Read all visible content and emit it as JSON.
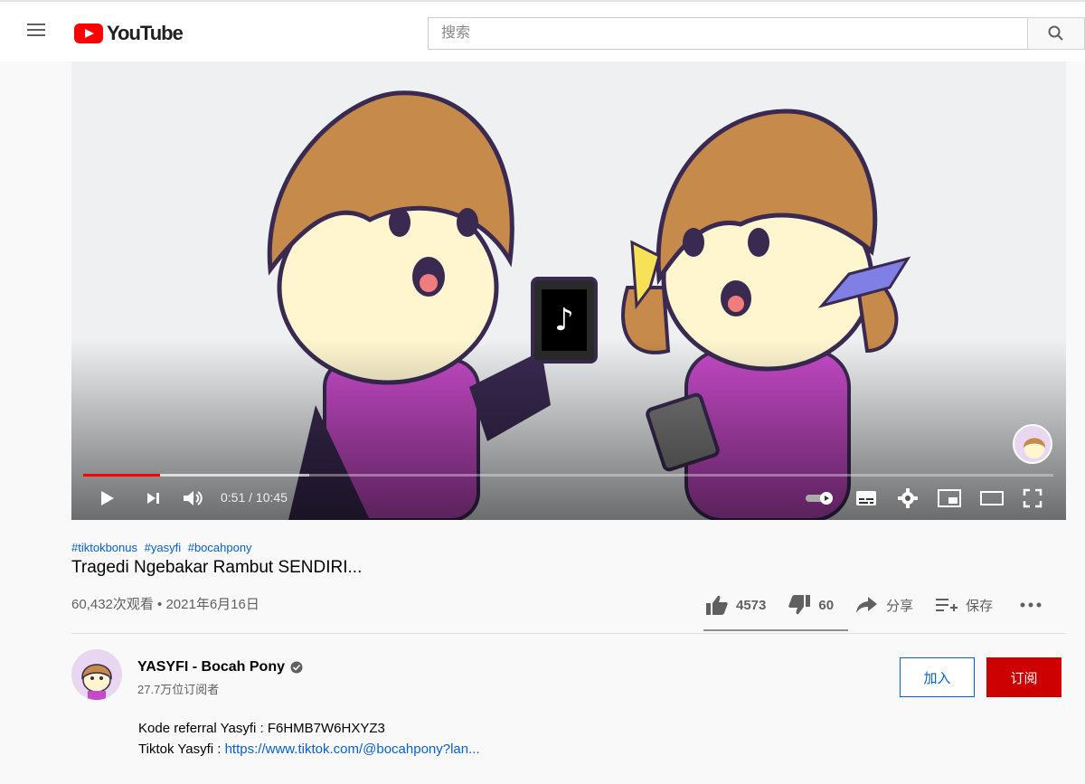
{
  "app": {
    "logo_text": "YouTube"
  },
  "search": {
    "placeholder": "搜索"
  },
  "player": {
    "current_time": "0:51",
    "duration": "10:45",
    "time_display": "0:51 / 10:45",
    "played_fraction": 0.079,
    "colors": {
      "progress_played": "#ff0000"
    }
  },
  "video": {
    "hashtags": [
      "#tiktokbonus",
      "#yasyfi",
      "#bocahpony"
    ],
    "title": "Tragedi Ngebakar Rambut SENDIRI...",
    "meta": "60,432次观看 • 2021年6月16日",
    "likes": "4573",
    "dislikes": "60",
    "share_label": "分享",
    "save_label": "保存"
  },
  "channel": {
    "name": "YASYFI - Bocah Pony",
    "subscribers": "27.7万位订阅者",
    "join_label": "加入",
    "subscribe_label": "订阅"
  },
  "description": {
    "line1": "Kode referral Yasyfi : F6HMB7W6HXYZ3",
    "line2_prefix": "Tiktok Yasyfi : ",
    "line2_link": "https://www.tiktok.com/@bocahpony?lan..."
  },
  "colors": {
    "brand": "#ff0000",
    "subscribe": "#cc0000",
    "link": "#065fd4"
  }
}
